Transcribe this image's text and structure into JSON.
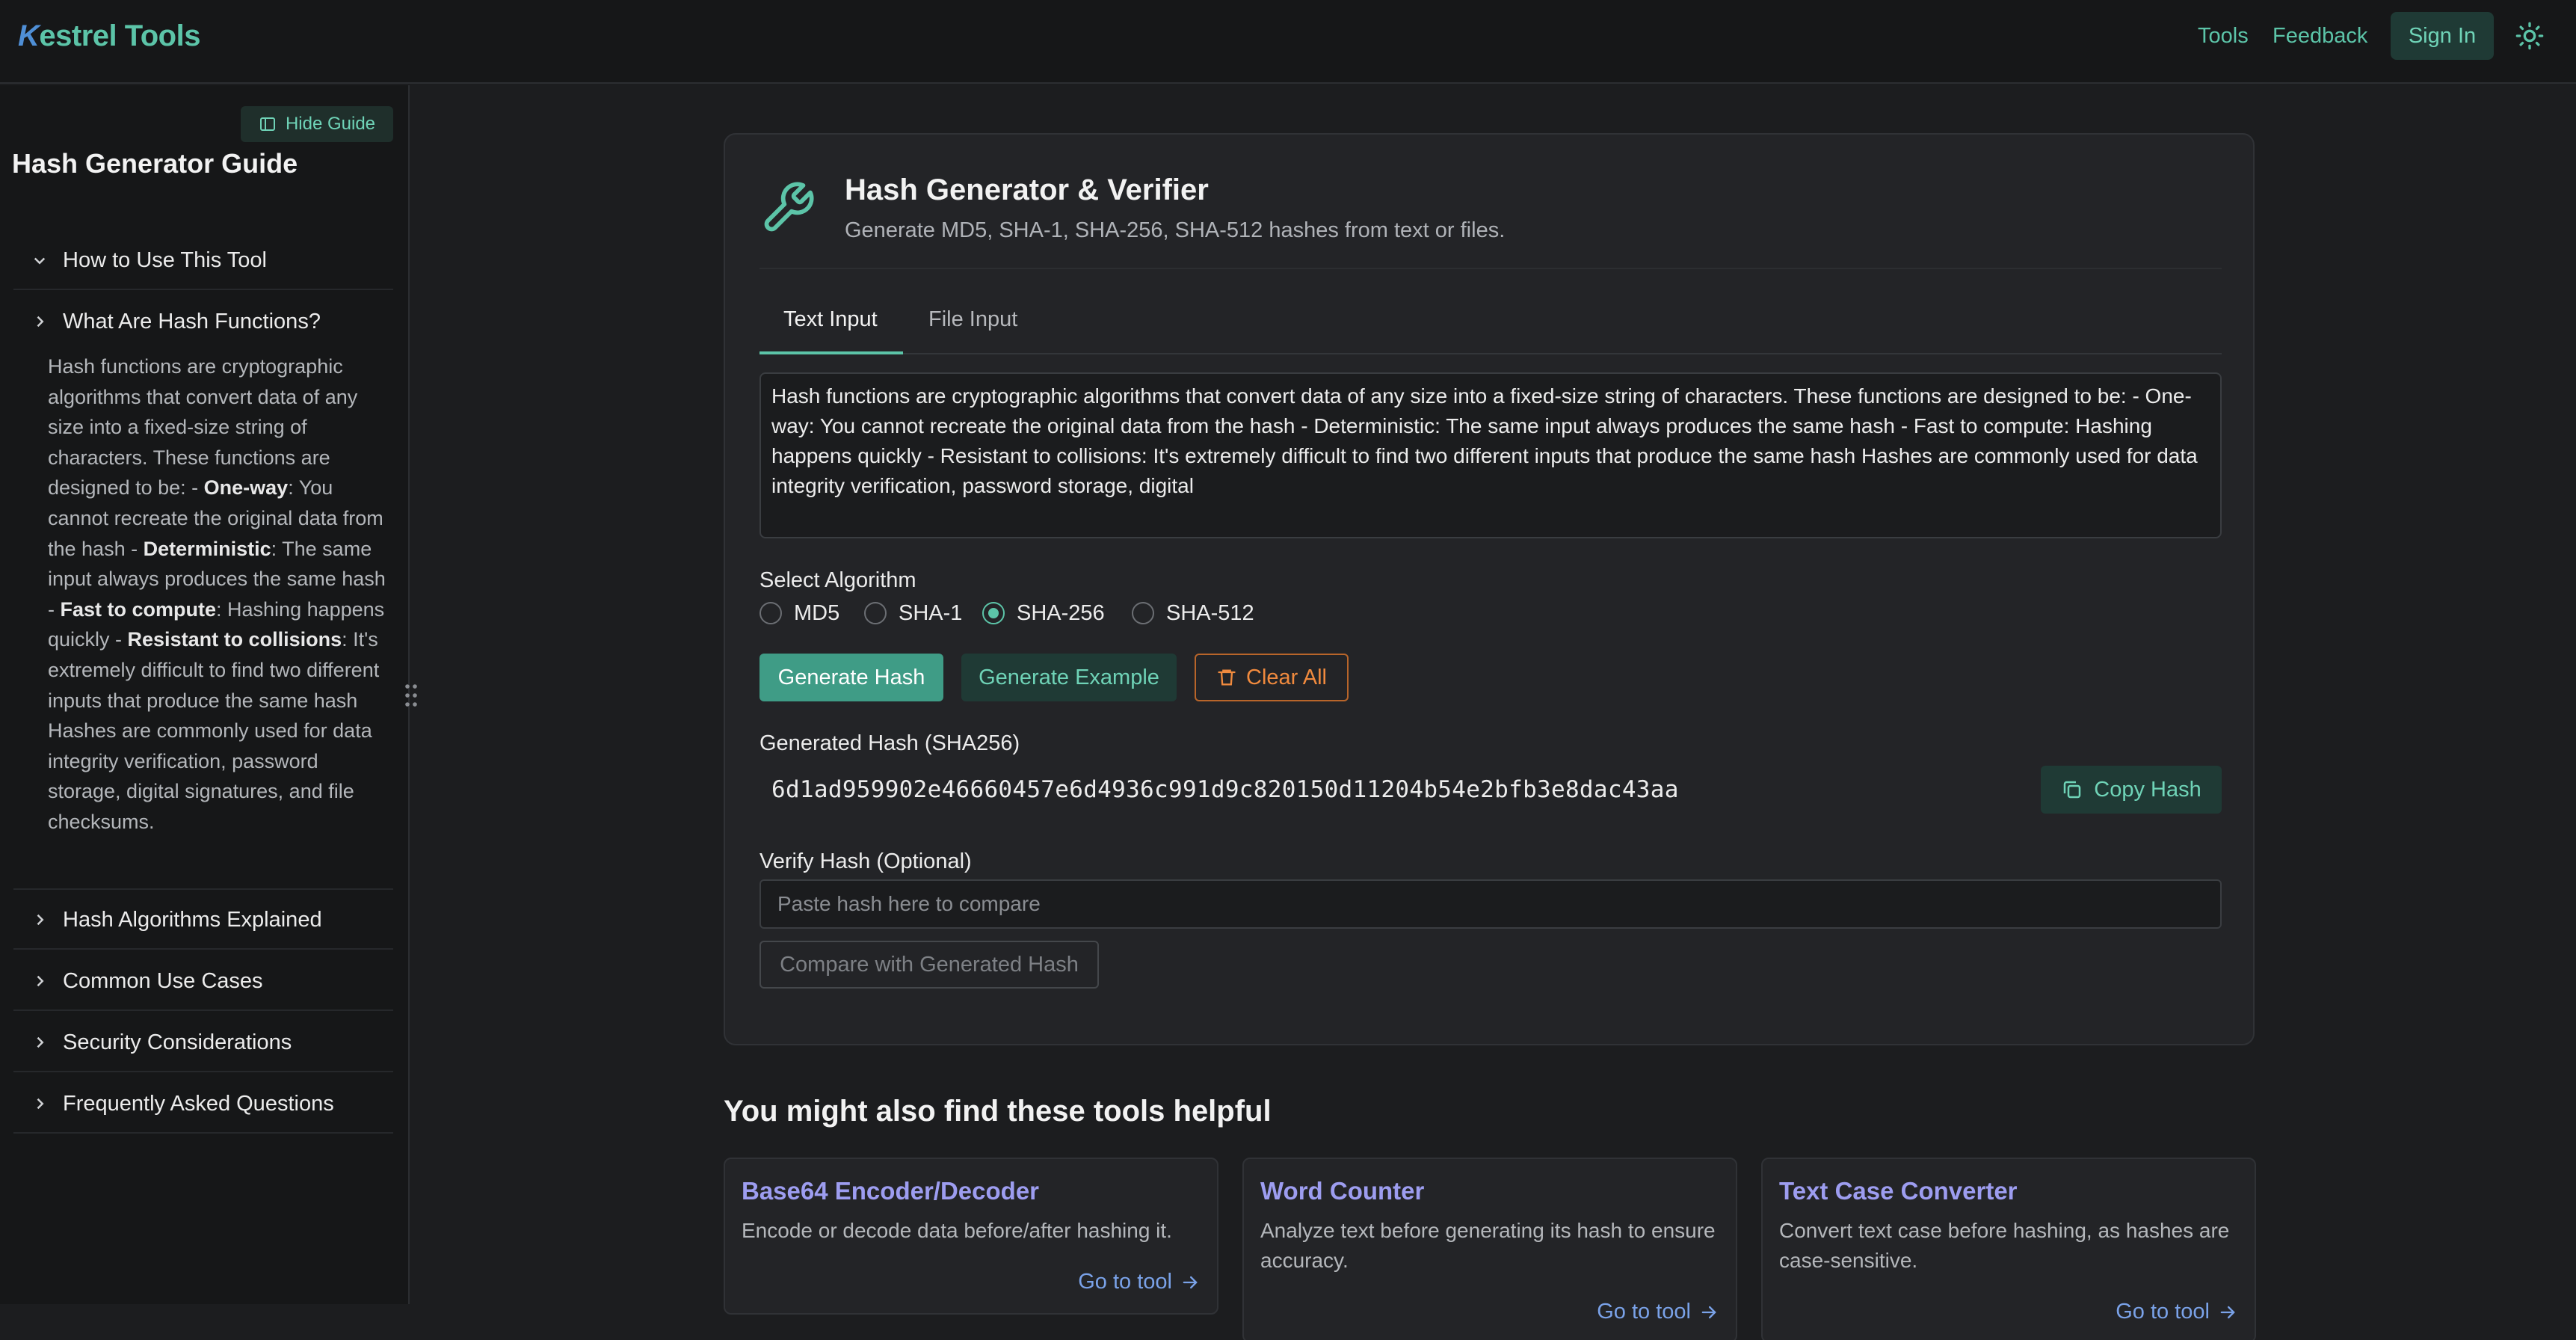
{
  "header": {
    "logo_k": "K",
    "logo_rest": "estrel Tools",
    "nav": [
      "Tools",
      "Feedback"
    ],
    "sign_in": "Sign In"
  },
  "sidebar": {
    "hide_guide": "Hide Guide",
    "title": "Hash Generator Guide",
    "items": [
      {
        "label": "How to Use This Tool"
      },
      {
        "label": "What Are Hash Functions?"
      },
      {
        "label": "Hash Algorithms Explained"
      },
      {
        "label": "Common Use Cases"
      },
      {
        "label": "Security Considerations"
      },
      {
        "label": "Frequently Asked Questions"
      }
    ],
    "expanded_body": {
      "p1": "Hash functions are cryptographic algorithms that convert data of any size into a fixed-size string of characters. These functions are designed to be: - ",
      "b1": "One-way",
      "p2": ": You cannot recreate the original data from the hash - ",
      "b2": "Deterministic",
      "p3": ": The same input always produces the same hash - ",
      "b3": "Fast to compute",
      "p4": ": Hashing happens quickly - ",
      "b4": "Resistant to collisions",
      "p5": ": It's extremely difficult to find two different inputs that produce the same hash Hashes are commonly used for data integrity verification, password storage, digital signatures, and file checksums."
    }
  },
  "tool": {
    "title": "Hash Generator & Verifier",
    "subtitle": "Generate MD5, SHA-1, SHA-256, SHA-512 hashes from text or files.",
    "tabs": [
      "Text Input",
      "File Input"
    ],
    "input_text": "Hash functions are cryptographic algorithms that convert data of any size into a fixed-size string of characters. These functions are designed to be: - One-way: You cannot recreate the original data from the hash - Deterministic: The same input always produces the same hash - Fast to compute: Hashing happens quickly - Resistant to collisions: It's extremely difficult to find two different inputs that produce the same hash Hashes are commonly used for data integrity verification, password storage, digital",
    "algorithm_label": "Select Algorithm",
    "algorithms": [
      "MD5",
      "SHA-1",
      "SHA-256",
      "SHA-512"
    ],
    "selected_algorithm": "SHA-256",
    "btn_generate": "Generate Hash",
    "btn_example": "Generate Example",
    "btn_clear": "Clear All",
    "generated_label": "Generated Hash (SHA256)",
    "hash_value": "6d1ad959902e46660457e6d4936c991d9c820150d11204b54e2bfb3e8dac43aa",
    "copy_label": "Copy Hash",
    "verify_label": "Verify Hash (Optional)",
    "verify_placeholder": "Paste hash here to compare",
    "compare_label": "Compare with Generated Hash"
  },
  "related": {
    "title": "You might also find these tools helpful",
    "cards": [
      {
        "name": "Base64 Encoder/Decoder",
        "desc": "Encode or decode data before/after hashing it.",
        "link": "Go to tool"
      },
      {
        "name": "Word Counter",
        "desc": "Analyze text before generating its hash to ensure accuracy.",
        "link": "Go to tool"
      },
      {
        "name": "Text Case Converter",
        "desc": "Convert text case before hashing, as hashes are case-sensitive.",
        "link": "Go to tool"
      }
    ]
  },
  "colors": {
    "accent": "#5cc4a8",
    "background": "#1c1d1f",
    "danger": "#f08a3e",
    "link": "#7aa2e8"
  }
}
